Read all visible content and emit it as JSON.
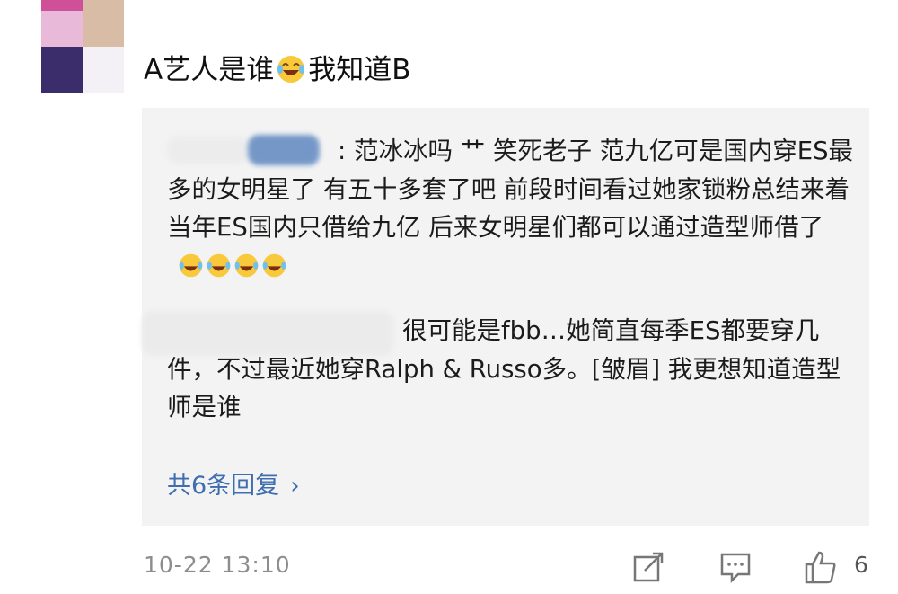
{
  "comment": {
    "text_prefix": "A艺人是谁",
    "emoji_name": "laughing-crying-emoji",
    "text_suffix": "我知道B",
    "time": "10-22 13:10",
    "like_count": "6"
  },
  "replies": [
    {
      "text": ": 范冰冰吗 艹 笑死老子 范九亿可是国内穿ES最多的女明星了 有五十多套了吧 前段时间看过她家锁粉总结来着 当年ES国内只借给九亿 后来女明星们都可以通过造型师借了",
      "emoji_count": 4
    },
    {
      "text": "很可能是fbb…她简直每季ES都要穿几件，不过最近她穿Ralph & Russo多。[皱眉] 我更想知道造型师是谁"
    }
  ],
  "more_replies": {
    "label": "共6条回复",
    "chevron": "›"
  },
  "colors": {
    "reply_background": "#f3f3f3",
    "link": "#3e6db0",
    "meta": "#8d8d8d"
  }
}
